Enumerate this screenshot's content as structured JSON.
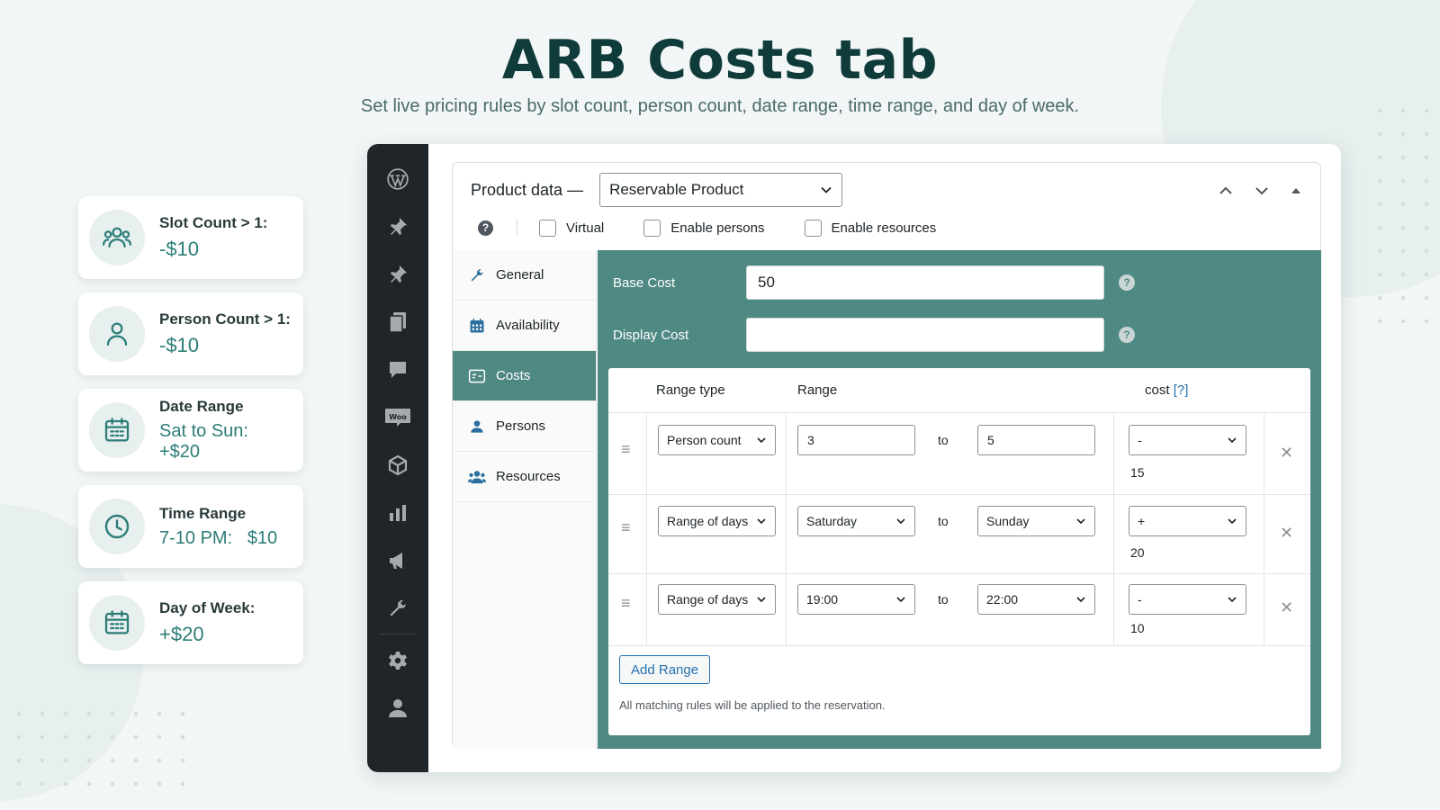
{
  "hero": {
    "title": "ARB Costs tab",
    "subtitle": "Set live pricing rules by slot count, person count, date range, time range, and day of week."
  },
  "cards": [
    {
      "icon": "users-icon",
      "title": "Slot Count > 1:",
      "value": "-$10"
    },
    {
      "icon": "person-icon",
      "title": "Person Count > 1:",
      "value": "-$10"
    },
    {
      "icon": "calendar-icon",
      "title": "Date Range",
      "value": "Sat to Sun: +$20"
    },
    {
      "icon": "clock-icon",
      "title": "Time Range",
      "value": "7-10 PM:   $10"
    },
    {
      "icon": "calendar-icon",
      "title": "Day of Week:",
      "value": "+$20"
    }
  ],
  "sidebar": {
    "icons": [
      "wordpress-logo-icon",
      "pin-icon",
      "pin-icon",
      "pages-icon",
      "comments-icon",
      "woo-icon",
      "products-icon",
      "analytics-icon",
      "marketing-icon",
      "tools-icon",
      "settings-icon",
      "user-icon"
    ]
  },
  "product_data": {
    "label": "Product data —",
    "type_value": "Reservable Product",
    "options": {
      "virtual": "Virtual",
      "enable_persons": "Enable persons",
      "enable_resources": "Enable resources"
    }
  },
  "tabs": [
    {
      "label": "General",
      "icon": "wrench-icon"
    },
    {
      "label": "Availability",
      "icon": "calendar-icon"
    },
    {
      "label": "Costs",
      "icon": "costs-icon",
      "active": true
    },
    {
      "label": "Persons",
      "icon": "person-icon"
    },
    {
      "label": "Resources",
      "icon": "users-icon"
    }
  ],
  "costs": {
    "base_cost_label": "Base Cost",
    "base_cost_value": "50",
    "display_cost_label": "Display Cost",
    "display_cost_value": "",
    "help": "?",
    "table": {
      "headers": {
        "range_type": "Range type",
        "range": "Range",
        "cost": "cost",
        "cost_help": "[?]"
      },
      "to_label": "to",
      "rows": [
        {
          "range_type": "Person count",
          "from": "3",
          "to": "5",
          "modifier": "-",
          "cost": "15"
        },
        {
          "range_type": "Range of days",
          "from": "Saturday",
          "to": "Sunday",
          "modifier": "+",
          "cost": "20"
        },
        {
          "range_type": "Range of days",
          "from": "19:00",
          "to": "22:00",
          "modifier": "-",
          "cost": "10"
        }
      ]
    },
    "add_range_label": "Add Range",
    "footnote": "All matching rules will be applied to the reservation."
  },
  "colors": {
    "accent": "#4f8984",
    "title": "#0f3b3b",
    "link": "#2271b1",
    "sidebar": "#1f2529"
  }
}
